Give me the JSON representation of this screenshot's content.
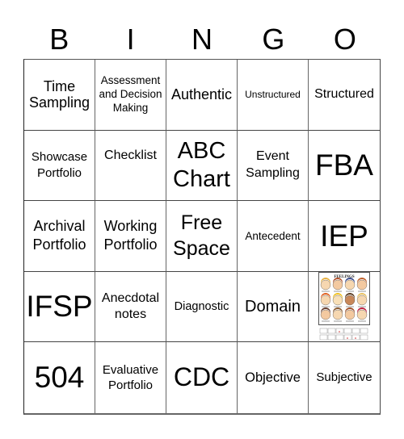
{
  "header": {
    "letters": [
      "B",
      "I",
      "N",
      "G",
      "O"
    ]
  },
  "cells": [
    {
      "text": "Time Sampling"
    },
    {
      "text": "Assessment and Decision Making"
    },
    {
      "text": "Authentic"
    },
    {
      "text": "Unstructured"
    },
    {
      "text": "Structured"
    },
    {
      "text": "Showcase Portfolio"
    },
    {
      "text": "Checklist"
    },
    {
      "text": "ABC Chart"
    },
    {
      "text": "Event Sampling"
    },
    {
      "text": "FBA"
    },
    {
      "text": "Archival Portfolio"
    },
    {
      "text": "Working Portfolio"
    },
    {
      "text": "Free Space"
    },
    {
      "text": "Antecedent"
    },
    {
      "text": "IEP"
    },
    {
      "text": "IFSP"
    },
    {
      "text": "Anecdotal notes"
    },
    {
      "text": "Diagnostic"
    },
    {
      "text": "Domain"
    },
    {
      "image": "feelings-chart",
      "image_title": "FEELINGS"
    },
    {
      "text": "504"
    },
    {
      "text": "Evaluative Portfolio"
    },
    {
      "text": "CDC"
    },
    {
      "text": "Objective"
    },
    {
      "text": "Subjective"
    }
  ]
}
